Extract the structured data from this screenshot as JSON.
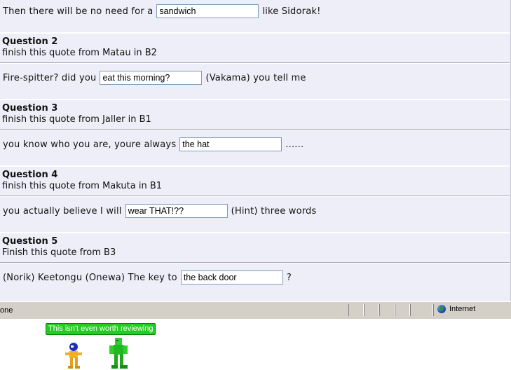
{
  "answer1": {
    "before": "Then there will be no need for a",
    "value": "sandwich",
    "after": "like Sidorak!"
  },
  "questions": [
    {
      "title": "Question 2",
      "prompt": "finish this quote from Matau in B2",
      "before": "Fire-spitter? did you",
      "value": "eat this morning?",
      "after": "(Vakama) you tell me"
    },
    {
      "title": "Question 3",
      "prompt": "finish this quote from Jaller in B1",
      "before": "you know who you are, youre always",
      "value": "the hat",
      "after": "......"
    },
    {
      "title": "Question 4",
      "prompt": "finish this quote from Makuta in B1",
      "before": "you actually believe I will",
      "value": "wear THAT!??",
      "after": "(Hint) three words"
    },
    {
      "title": "Question 5",
      "prompt": "Finish this quote from B3",
      "before": "(Norik) Keetongu (Onewa) The key to",
      "value": "the back door",
      "after": "?"
    }
  ],
  "statusbar": {
    "message": "one",
    "zone_label": "Internet",
    "zone_icon": "globe-icon"
  },
  "badge": {
    "text": "This isn't even worth reviewing",
    "color": "#22cc22"
  },
  "sprites": [
    {
      "name": "blue-gold-figure-sprite"
    },
    {
      "name": "green-figure-sprite"
    }
  ]
}
